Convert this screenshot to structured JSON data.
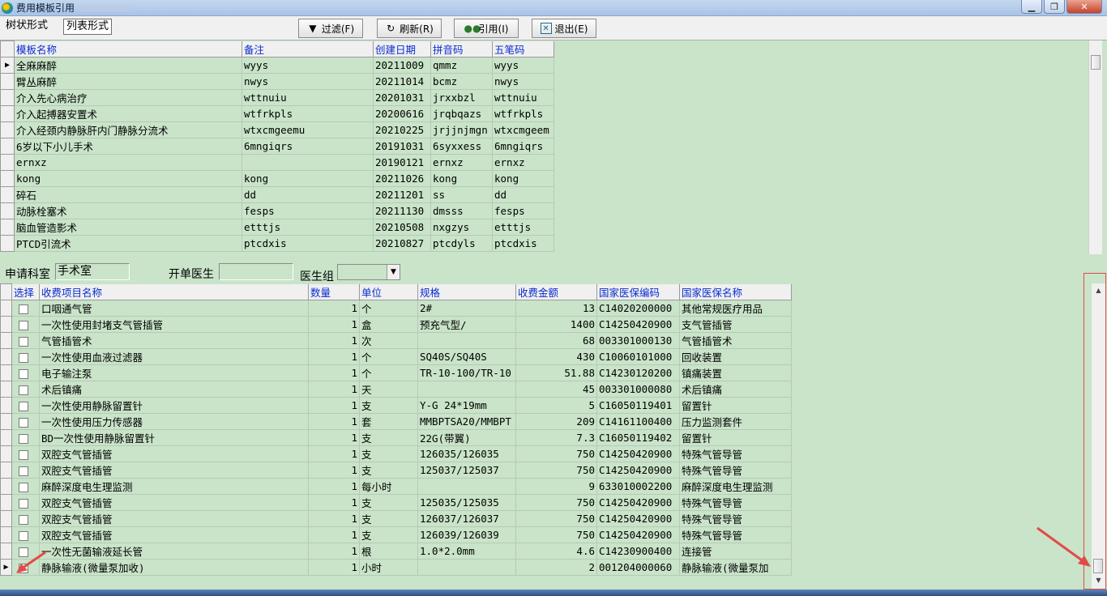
{
  "window": {
    "title": "费用模板引用",
    "title_blur": "..."
  },
  "toolbar": {
    "tree_tab": "树状形式",
    "list_tab": "列表形式",
    "filter": "过滤(F)",
    "refresh": "刷新(R)",
    "cite": "引用(I)",
    "exit": "退出(E)"
  },
  "templates": {
    "headers": [
      "模板名称",
      "备注",
      "创建日期",
      "拼音码",
      "五笔码"
    ],
    "rows": [
      [
        "全麻麻醉",
        "wyys",
        "20211009",
        "qmmz",
        "wyys"
      ],
      [
        "臂丛麻醉",
        "nwys",
        "20211014",
        "bcmz",
        "nwys"
      ],
      [
        "介入先心病治疗",
        "wttnuiu",
        "20201031",
        "jrxxbzl",
        "wttnuiu"
      ],
      [
        "介入起搏器安置术",
        "wtfrkpls",
        "20200616",
        "jrqbqazs",
        "wtfrkpls"
      ],
      [
        "介入经颈内静脉肝内门静脉分流术",
        "wtxcmgeemu",
        "20210225",
        "jrjjnjmgn",
        "wtxcmgeem"
      ],
      [
        "6岁以下小儿手术",
        "6mngiqrs",
        "20191031",
        "6syxxess",
        "6mngiqrs"
      ],
      [
        "ernxz",
        "",
        "20190121",
        "ernxz",
        "ernxz"
      ],
      [
        "kong",
        "kong",
        "20211026",
        "kong",
        "kong"
      ],
      [
        "碎石",
        "dd",
        "20211201",
        "ss",
        "dd"
      ],
      [
        "动脉栓塞术",
        "fesps",
        "20211130",
        "dmsss",
        "fesps"
      ],
      [
        "脑血管造影术",
        "etttjs",
        "20210508",
        "nxgzys",
        "etttjs"
      ],
      [
        "PTCD引流术",
        "ptcdxis",
        "20210827",
        "ptcdyls",
        "ptcdxis"
      ]
    ]
  },
  "info": {
    "dept_label": "申请科室",
    "dept_value": "手术室",
    "doctor_label": "开单医生",
    "doctor_value": "",
    "group_label": "医生组",
    "group_value": ""
  },
  "items": {
    "headers": [
      "选择",
      "收费项目名称",
      "数量",
      "单位",
      "规格",
      "收费金额",
      "国家医保编码",
      "国家医保名称"
    ],
    "rows": [
      [
        "口咽通气管",
        "1",
        "个",
        "2#",
        "13",
        "C14020200000",
        "其他常规医疗用品"
      ],
      [
        "一次性使用封堵支气管插管",
        "1",
        "盒",
        "预充气型/",
        "1400",
        "C14250420900",
        "支气管插管"
      ],
      [
        "气管插管术",
        "1",
        "次",
        "",
        "68",
        "003301000130",
        "气管插管术"
      ],
      [
        "一次性使用血液过滤器",
        "1",
        "个",
        "SQ40S/SQ40S",
        "430",
        "C10060101000",
        "回收装置"
      ],
      [
        "电子输注泵",
        "1",
        "个",
        "TR-10-100/TR-10",
        "51.88",
        "C14230120200",
        "镇痛装置"
      ],
      [
        "术后镇痛",
        "1",
        "天",
        "",
        "45",
        "003301000080",
        "术后镇痛"
      ],
      [
        "一次性使用静脉留置针",
        "1",
        "支",
        "Y-G 24*19mm",
        "5",
        "C16050119401",
        "留置针"
      ],
      [
        "一次性使用压力传感器",
        "1",
        "套",
        "MMBPTSA20/MMBPT",
        "209",
        "C14161100400",
        "压力监测套件"
      ],
      [
        "BD一次性使用静脉留置针",
        "1",
        "支",
        "22G(带翼)",
        "7.3",
        "C16050119402",
        "留置针"
      ],
      [
        "双腔支气管插管",
        "1",
        "支",
        "126035/126035",
        "750",
        "C14250420900",
        "特殊气管导管"
      ],
      [
        "双腔支气管插管",
        "1",
        "支",
        "125037/125037",
        "750",
        "C14250420900",
        "特殊气管导管"
      ],
      [
        "麻醉深度电生理监测",
        "1",
        "每小时",
        "",
        "9",
        "633010002200",
        "麻醉深度电生理监测"
      ],
      [
        "双腔支气管插管",
        "1",
        "支",
        "125035/125035",
        "750",
        "C14250420900",
        "特殊气管导管"
      ],
      [
        "双腔支气管插管",
        "1",
        "支",
        "126037/126037",
        "750",
        "C14250420900",
        "特殊气管导管"
      ],
      [
        "双腔支气管插管",
        "1",
        "支",
        "126039/126039",
        "750",
        "C14250420900",
        "特殊气管导管"
      ],
      [
        "一次性无菌输液延长管",
        "1",
        "根",
        "1.0*2.0mm",
        "4.6",
        "C14230900400",
        "连接管"
      ],
      [
        "静脉输液(微量泵加收)",
        "1",
        "小时",
        "",
        "2",
        "001204000060",
        "静脉输液(微量泵加"
      ]
    ]
  },
  "colors": {
    "grid_bg": "#c9e4c9",
    "header_text": "#0a2ccf",
    "annotation": "#e24a4a"
  }
}
